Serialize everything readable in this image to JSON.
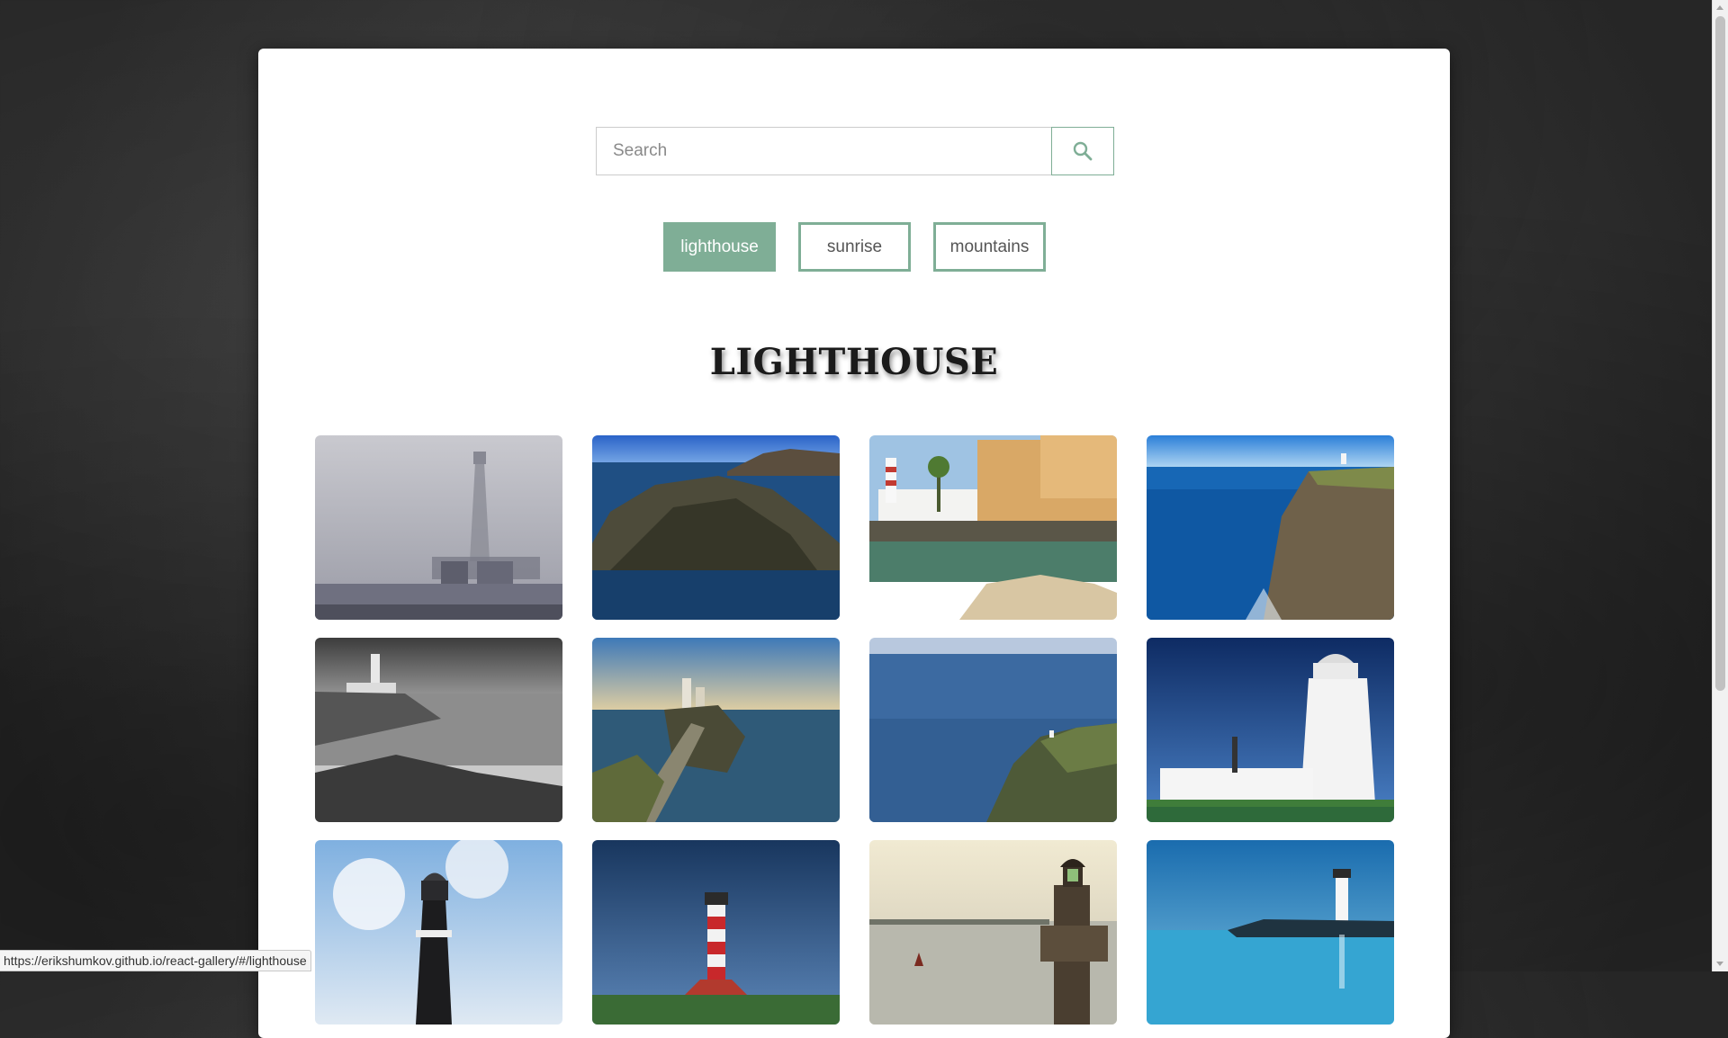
{
  "search": {
    "placeholder": "Search",
    "value": ""
  },
  "tags": [
    {
      "label": "lighthouse",
      "active": true
    },
    {
      "label": "sunrise",
      "active": false
    },
    {
      "label": "mountains",
      "active": false
    }
  ],
  "gallery": {
    "title": "LIGHTHOUSE",
    "photos": [
      {
        "icon": "foggy-lighthouse-photo"
      },
      {
        "icon": "rocky-coast-photo"
      },
      {
        "icon": "coastal-town-lighthouse-photo"
      },
      {
        "icon": "sea-cliff-lighthouse-photo"
      },
      {
        "icon": "black-white-lighthouse-photo"
      },
      {
        "icon": "lighthouse-causeway-photo"
      },
      {
        "icon": "ocean-cliff-photo"
      },
      {
        "icon": "white-lighthouse-photo"
      },
      {
        "icon": "black-lighthouse-photo"
      },
      {
        "icon": "striped-lighthouse-photo"
      },
      {
        "icon": "harbor-lighthouse-photo"
      },
      {
        "icon": "pier-lighthouse-photo"
      }
    ]
  },
  "status_bar": {
    "url": "https://erikshumkov.github.io/react-gallery/#/lighthouse"
  },
  "colors": {
    "accent": "#7fae96"
  }
}
